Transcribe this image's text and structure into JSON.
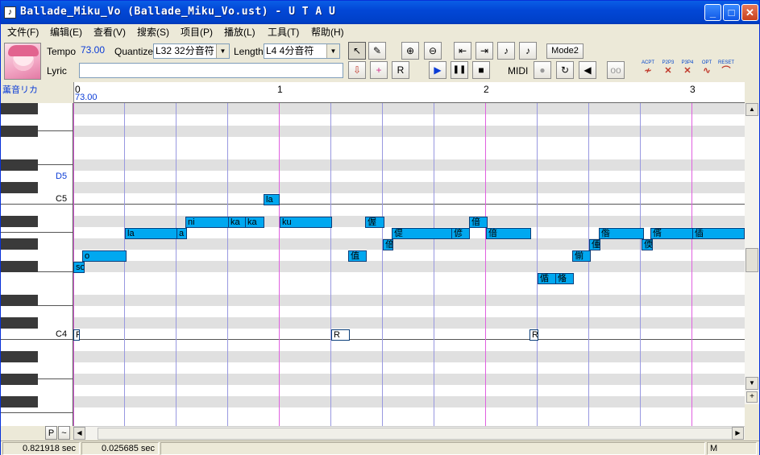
{
  "window": {
    "title": "Ballade_Miku_Vo (Ballade_Miku_Vo.ust) - U T A U",
    "app_icon": "music-note-icon",
    "buttons": {
      "minimize": "_",
      "maximize": "□",
      "close": "✕"
    }
  },
  "menu": [
    {
      "label": "文件(F)"
    },
    {
      "label": "编辑(E)"
    },
    {
      "label": "查看(V)"
    },
    {
      "label": "搜索(S)"
    },
    {
      "label": "项目(P)"
    },
    {
      "label": "播放(L)"
    },
    {
      "label": "工具(T)"
    },
    {
      "label": "帮助(H)"
    }
  ],
  "toolbar": {
    "tempo_label": "Tempo",
    "tempo_value": "73.00",
    "quantize_label": "Quantize",
    "quantize_value": "L32 32分音符",
    "length_label": "Length",
    "length_value": "L4 4分音符",
    "lyric_label": "Lyric",
    "lyric_value": "",
    "mode_button": "Mode2",
    "midi_label": "MIDI",
    "icons": {
      "pointer": "↖",
      "pencil": "✎",
      "zoom_in": "⊕",
      "zoom_out": "⊖",
      "go_start": "⇤",
      "go_end": "⇥",
      "split": "♪",
      "merge": "♪",
      "insert_a": "⇩",
      "insert_b": "+",
      "insert_r": "R",
      "play": "▶",
      "pause": "❚❚",
      "stop": "■",
      "midi_rec": "●",
      "midi_loop": "↻",
      "speaker": "◀",
      "extra": "oo"
    },
    "small_buttons": [
      {
        "top": "ACPT",
        "glyph": "≁"
      },
      {
        "top": "P2P3",
        "glyph": "✕"
      },
      {
        "top": "P3P4",
        "glyph": "✕"
      },
      {
        "top": "OPT",
        "glyph": "∿"
      },
      {
        "top": "RESET",
        "glyph": "⌒"
      }
    ]
  },
  "voice": {
    "name": "薫音リカ"
  },
  "ruler": {
    "bars": [
      "0",
      "1",
      "2",
      "3"
    ],
    "tempo_marker": "73.00"
  },
  "keyboard": {
    "labels": [
      {
        "text": "D5"
      },
      {
        "text": "C5"
      },
      {
        "text": "C4"
      }
    ]
  },
  "notes": [
    {
      "lyric": "so"
    },
    {
      "lyric": "o"
    },
    {
      "lyric": "la"
    },
    {
      "lyric": "a"
    },
    {
      "lyric": "ni"
    },
    {
      "lyric": "ka"
    },
    {
      "lyric": "ka"
    },
    {
      "lyric": "la"
    },
    {
      "lyric": "ku"
    },
    {
      "lyric": "值"
    },
    {
      "lyric": "偓"
    },
    {
      "lyric": "偣"
    },
    {
      "lyric": "偍"
    },
    {
      "lyric": "偐"
    },
    {
      "lyric": "偣"
    },
    {
      "lyric": "偣"
    },
    {
      "lyric": "偱"
    },
    {
      "lyric": "偹"
    },
    {
      "lyric": "偂"
    },
    {
      "lyric": "偅"
    },
    {
      "lyric": "偺"
    },
    {
      "lyric": "偄"
    },
    {
      "lyric": "偦"
    },
    {
      "lyric": "偛"
    },
    {
      "lyric": "偑"
    },
    {
      "lyric": "R"
    },
    {
      "lyric": "R"
    },
    {
      "lyric": "R"
    }
  ],
  "status": {
    "position": "0.821918 sec",
    "length": "0.025685 sec",
    "mode": "M"
  },
  "bottom": {
    "p_button": "P",
    "tilde_button": "~"
  }
}
